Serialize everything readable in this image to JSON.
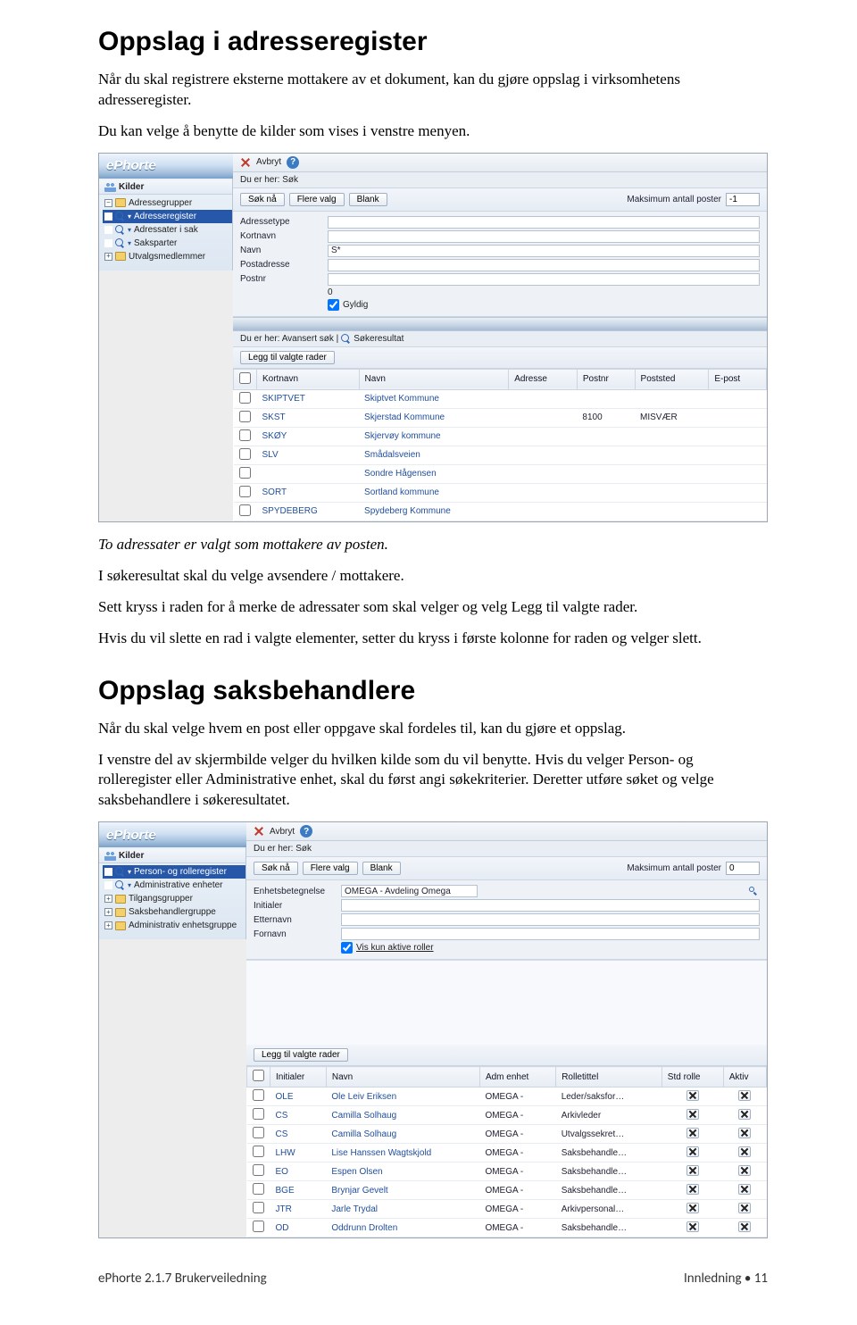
{
  "doc": {
    "h1": "Oppslag i adresseregister",
    "p1": "Når du skal registrere eksterne mottakere av et dokument, kan du gjøre oppslag i virksomhetens adresseregister.",
    "p2": "Du kan velge å benytte de kilder som vises i venstre menyen.",
    "caption1": "To adressater er valgt som mottakere av posten.",
    "p3": "I søkeresultat skal du velge avsendere / mottakere.",
    "p4": "Sett kryss i raden for å merke de adressater som skal velger og velg Legg til valgte rader.",
    "p5": "Hvis du vil slette en rad i valgte elementer, setter du kryss i første kolonne for raden og velger slett.",
    "h2": "Oppslag saksbehandlere",
    "p6": "Når du skal velge hvem en post eller oppgave skal fordeles til, kan du gjøre et oppslag.",
    "p7": " I venstre del av skjermbilde velger du hvilken kilde som du vil benytte. Hvis du velger Person- og rolleregister eller Administrative enhet, skal du først angi søkekriterier. Deretter utføre søket og velge saksbehandlere i søkeresultatet."
  },
  "app1": {
    "brand": "ePhorte",
    "toolbar": {
      "avbryt": "Avbryt"
    },
    "sidebar_title": "Kilder",
    "tree": [
      {
        "exp": "−",
        "icon": "folder",
        "label": "Adressegrupper"
      },
      {
        "exp": "",
        "icon": "mag",
        "label": "Adresseregister",
        "sel": true,
        "chev": true
      },
      {
        "exp": "",
        "icon": "mag",
        "label": "Adressater i sak",
        "chev": true
      },
      {
        "exp": "",
        "icon": "mag",
        "label": "Saksparter",
        "chev": true
      },
      {
        "exp": "+",
        "icon": "folder",
        "label": "Utvalgsmedlemmer"
      }
    ],
    "locbar": "Du er her: Søk",
    "buttons": {
      "sok": "Søk nå",
      "flere": "Flere valg",
      "blank": "Blank"
    },
    "max_label": "Maksimum antall poster",
    "max_value": "-1",
    "form": {
      "rows": [
        {
          "label": "Adressetype",
          "value": ""
        },
        {
          "label": "Kortnavn",
          "value": ""
        },
        {
          "label": "Navn",
          "value": "S*"
        },
        {
          "label": "Postadresse",
          "value": ""
        },
        {
          "label": "Postnr",
          "value": ""
        }
      ],
      "zero": "0",
      "gyldig": "Gyldig"
    },
    "locbar2_prefix": "Du er her: Avansert søk  |",
    "locbar2_suffix": "Søkeresultat",
    "legg_til": "Legg til valgte rader",
    "columns": [
      "",
      "Kortnavn",
      "Navn",
      "Adresse",
      "Postnr",
      "Poststed",
      "E-post"
    ],
    "rows": [
      {
        "k": "SKIPTVET",
        "n": "Skiptvet Kommune",
        "a": "",
        "pn": "",
        "ps": "",
        "e": ""
      },
      {
        "k": "SKST",
        "n": "Skjerstad Kommune",
        "a": "",
        "pn": "8100",
        "ps": "MISVÆR",
        "e": ""
      },
      {
        "k": "SKØY",
        "n": "Skjervøy kommune",
        "a": "",
        "pn": "",
        "ps": "",
        "e": ""
      },
      {
        "k": "SLV",
        "n": "Smådalsveien",
        "a": "",
        "pn": "",
        "ps": "",
        "e": ""
      },
      {
        "k": "",
        "n": "Sondre Hågensen",
        "a": "",
        "pn": "",
        "ps": "",
        "e": ""
      },
      {
        "k": "SORT",
        "n": "Sortland kommune",
        "a": "",
        "pn": "",
        "ps": "",
        "e": ""
      },
      {
        "k": "SPYDEBERG",
        "n": "Spydeberg Kommune",
        "a": "",
        "pn": "",
        "ps": "",
        "e": ""
      }
    ]
  },
  "app2": {
    "brand": "ePhorte",
    "toolbar": {
      "avbryt": "Avbryt"
    },
    "sidebar_title": "Kilder",
    "tree": [
      {
        "exp": "",
        "icon": "mag",
        "label": "Person- og rolleregister",
        "sel": true,
        "chev": true
      },
      {
        "exp": "",
        "icon": "mag",
        "label": "Administrative enheter",
        "chev": true
      },
      {
        "exp": "+",
        "icon": "folder",
        "label": "Tilgangsgrupper"
      },
      {
        "exp": "+",
        "icon": "folder",
        "label": "Saksbehandlergruppe"
      },
      {
        "exp": "+",
        "icon": "folder",
        "label": "Administrativ enhetsgruppe"
      }
    ],
    "locbar": "Du er her: Søk",
    "buttons": {
      "sok": "Søk nå",
      "flere": "Flere valg",
      "blank": "Blank"
    },
    "max_label": "Maksimum antall poster",
    "max_value": "0",
    "form": {
      "rows": [
        {
          "label": "Enhetsbetegnelse",
          "value": "OMEGA - Avdeling Omega",
          "lookup": true
        },
        {
          "label": "Initialer",
          "value": ""
        },
        {
          "label": "Etternavn",
          "value": ""
        },
        {
          "label": "Fornavn",
          "value": ""
        }
      ],
      "vis_kun": "Vis kun aktive roller"
    },
    "legg_til": "Legg til valgte rader",
    "columns": [
      "",
      "Initialer",
      "Navn",
      "Adm enhet",
      "Rolletittel",
      "Std rolle",
      "Aktiv"
    ],
    "rows": [
      {
        "i": "OLE",
        "n": "Ole Leiv Eriksen",
        "a": "OMEGA -",
        "r": "Leder/saksfor…"
      },
      {
        "i": "CS",
        "n": "Camilla Solhaug",
        "a": "OMEGA -",
        "r": "Arkivleder"
      },
      {
        "i": "CS",
        "n": "Camilla Solhaug",
        "a": "OMEGA -",
        "r": "Utvalgssekret…"
      },
      {
        "i": "LHW",
        "n": "Lise Hanssen Wagtskjold",
        "a": "OMEGA -",
        "r": "Saksbehandle…"
      },
      {
        "i": "EO",
        "n": "Espen Olsen",
        "a": "OMEGA -",
        "r": "Saksbehandle…"
      },
      {
        "i": "BGE",
        "n": "Brynjar Gevelt",
        "a": "OMEGA -",
        "r": "Saksbehandle…"
      },
      {
        "i": "JTR",
        "n": "Jarle Trydal",
        "a": "OMEGA -",
        "r": "Arkivpersonal…"
      },
      {
        "i": "OD",
        "n": "Oddrunn Drolten",
        "a": "OMEGA -",
        "r": "Saksbehandle…"
      }
    ]
  },
  "footer": {
    "left": "ePhorte 2.1.7 Brukerveiledning",
    "right": "Innledning  •  11"
  }
}
